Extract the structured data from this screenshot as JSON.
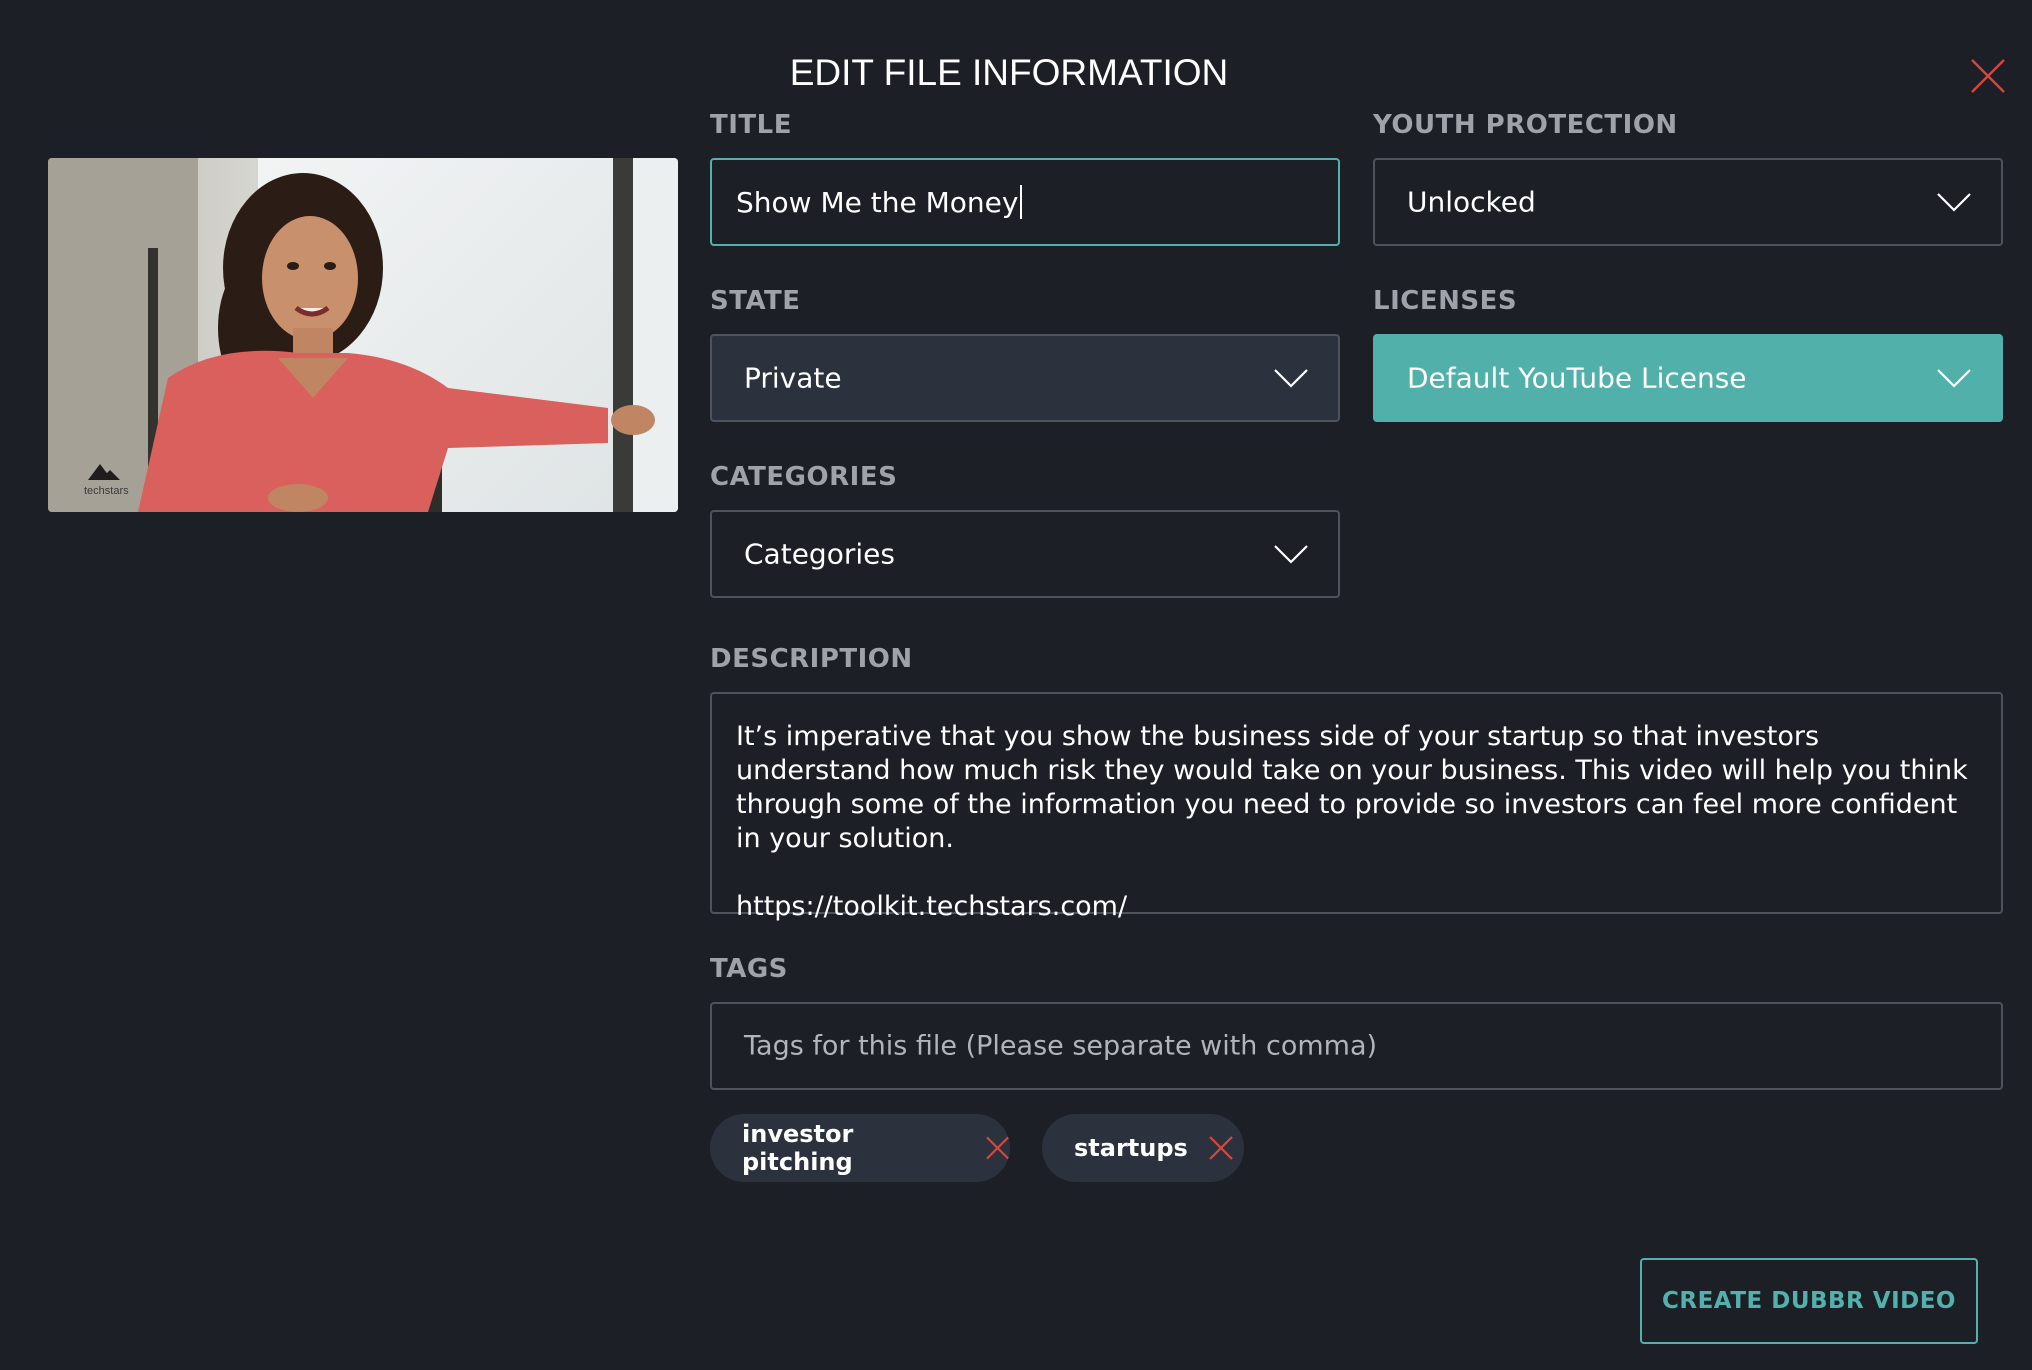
{
  "modal": {
    "title": "EDIT FILE INFORMATION",
    "close_icon": "close-icon"
  },
  "thumbnail": {
    "watermark_text": "techstars"
  },
  "fields": {
    "title": {
      "label": "TITLE",
      "value": "Show Me the Money"
    },
    "youth_protection": {
      "label": "YOUTH PROTECTION",
      "value": "Unlocked"
    },
    "state": {
      "label": "STATE",
      "value": "Private"
    },
    "licenses": {
      "label": "LICENSES",
      "value": "Default YouTube License"
    },
    "categories": {
      "label": "CATEGORIES",
      "value": "Categories"
    },
    "description": {
      "label": "DESCRIPTION",
      "value": "It’s imperative that you show the business side of your startup so that investors understand how much risk they would take on your business. This video will help you think through some of the information you need to provide so investors can feel more confident in your solution.\n\nhttps://toolkit.techstars.com/"
    },
    "tags": {
      "label": "TAGS",
      "placeholder": "Tags for this file (Please separate with comma)",
      "items": [
        "investor pitching",
        "startups"
      ]
    }
  },
  "actions": {
    "create_label": "CREATE DUBBR VIDEO"
  },
  "colors": {
    "background": "#1c1f26",
    "accent": "#53b1ad",
    "field_border": "#4d535d",
    "chip_bg": "#2c323d",
    "remove_x": "#d9463f",
    "label": "#9ea2a9"
  }
}
